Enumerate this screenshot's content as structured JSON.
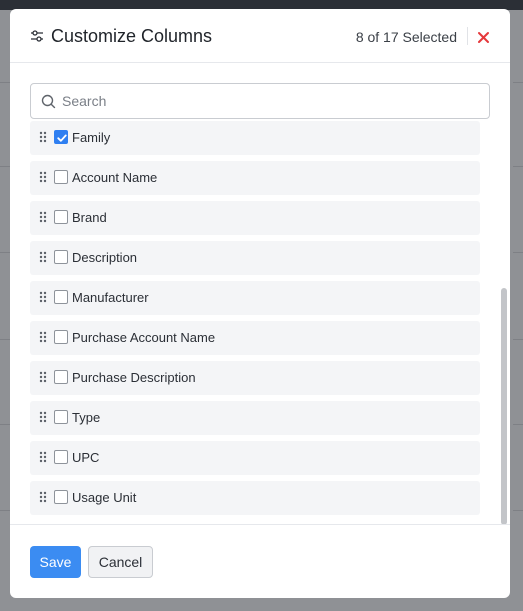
{
  "modal": {
    "title": "Customize Columns",
    "title_icon": "sliders-icon",
    "selected_count": "8 of 17 Selected",
    "close_icon": "close-icon"
  },
  "search": {
    "placeholder": "Search",
    "value": ""
  },
  "columns": [
    {
      "label": "Family",
      "checked": true
    },
    {
      "label": "Account Name",
      "checked": false
    },
    {
      "label": "Brand",
      "checked": false
    },
    {
      "label": "Description",
      "checked": false
    },
    {
      "label": "Manufacturer",
      "checked": false
    },
    {
      "label": "Purchase Account Name",
      "checked": false
    },
    {
      "label": "Purchase Description",
      "checked": false
    },
    {
      "label": "Type",
      "checked": false
    },
    {
      "label": "UPC",
      "checked": false
    },
    {
      "label": "Usage Unit",
      "checked": false
    }
  ],
  "footer": {
    "save_label": "Save",
    "cancel_label": "Cancel"
  },
  "colors": {
    "accent": "#3b8cf2",
    "checkbox_checked": "#2f7ff1",
    "close": "#e5383b",
    "item_bg": "#f4f5f7"
  }
}
